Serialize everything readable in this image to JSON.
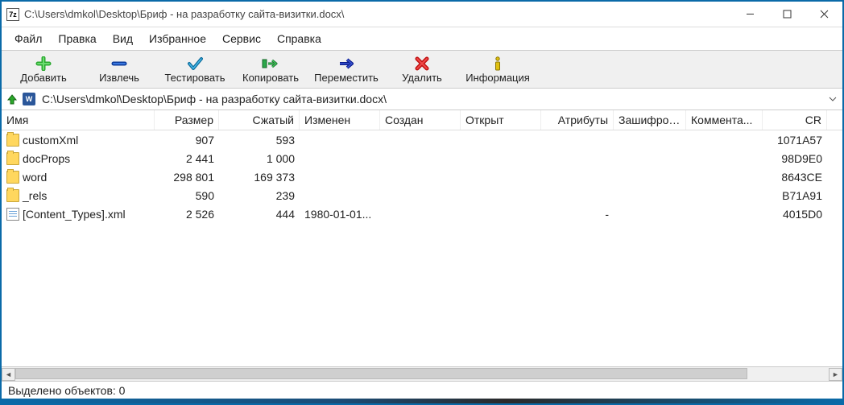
{
  "title": "C:\\Users\\dmkol\\Desktop\\Бриф - на разработку сайта-визитки.docx\\",
  "app_icon_text": "7z",
  "menus": [
    "Файл",
    "Правка",
    "Вид",
    "Избранное",
    "Сервис",
    "Справка"
  ],
  "toolbar": [
    {
      "label": "Добавить"
    },
    {
      "label": "Извлечь"
    },
    {
      "label": "Тестировать"
    },
    {
      "label": "Копировать"
    },
    {
      "label": "Переместить"
    },
    {
      "label": "Удалить"
    },
    {
      "label": "Информация"
    }
  ],
  "path": "C:\\Users\\dmkol\\Desktop\\Бриф - на разработку сайта-визитки.docx\\",
  "columns": [
    "Имя",
    "Размер",
    "Сжатый",
    "Изменен",
    "Создан",
    "Открыт",
    "Атрибуты",
    "Зашифров...",
    "Коммента...",
    "CR"
  ],
  "rows": [
    {
      "type": "folder",
      "name": "customXml",
      "size": "907",
      "packed": "593",
      "modified": "",
      "created": "",
      "accessed": "",
      "attr": "",
      "enc": "",
      "comment": "",
      "crc": "1071A57"
    },
    {
      "type": "folder",
      "name": "docProps",
      "size": "2 441",
      "packed": "1 000",
      "modified": "",
      "created": "",
      "accessed": "",
      "attr": "",
      "enc": "",
      "comment": "",
      "crc": "98D9E0"
    },
    {
      "type": "folder",
      "name": "word",
      "size": "298 801",
      "packed": "169 373",
      "modified": "",
      "created": "",
      "accessed": "",
      "attr": "",
      "enc": "",
      "comment": "",
      "crc": "8643CE"
    },
    {
      "type": "folder",
      "name": "_rels",
      "size": "590",
      "packed": "239",
      "modified": "",
      "created": "",
      "accessed": "",
      "attr": "",
      "enc": "",
      "comment": "",
      "crc": "B71A91"
    },
    {
      "type": "file",
      "name": "[Content_Types].xml",
      "size": "2 526",
      "packed": "444",
      "modified": "1980-01-01...",
      "created": "",
      "accessed": "",
      "attr": "-",
      "enc": "",
      "comment": "",
      "crc": "4015D0"
    }
  ],
  "status": "Выделено объектов: 0"
}
